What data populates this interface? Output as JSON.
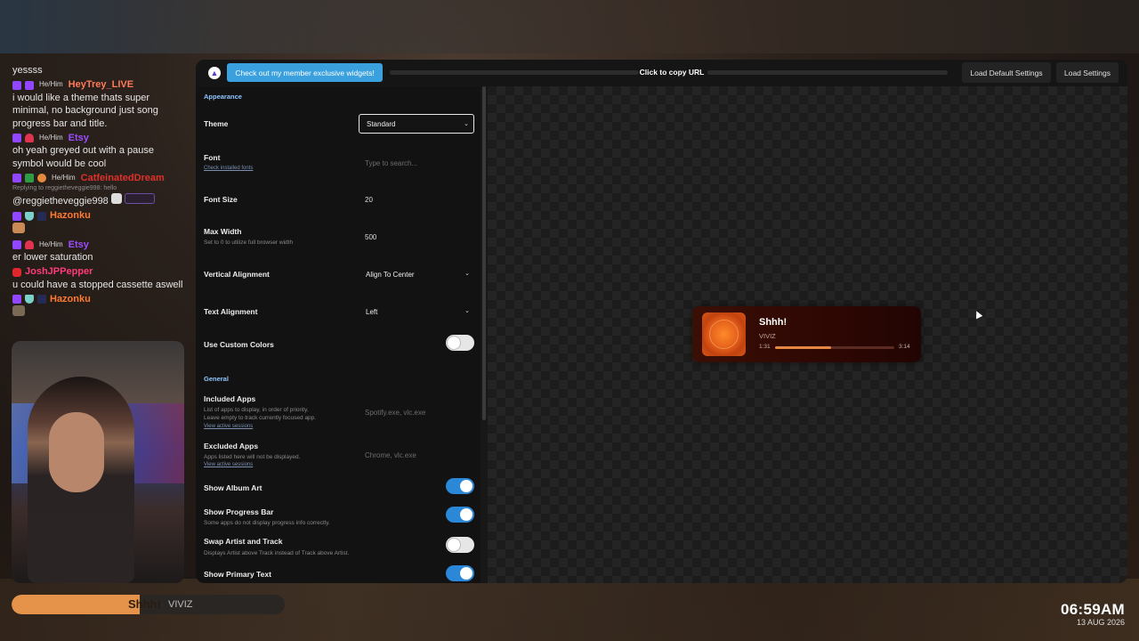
{
  "chat": {
    "messages": [
      {
        "user": "",
        "text": "yessss"
      },
      {
        "pronoun": "He/Him",
        "user": "HeyTrey_LIVE",
        "color": "#ff7a59",
        "text": "i would like a theme thats super minimal, no background just song progress bar and title."
      },
      {
        "pronoun": "He/Him",
        "user": "Etsy",
        "color": "#9b4dff",
        "text": "oh yeah greyed out with a pause symbol would be cool"
      },
      {
        "pronoun": "He/Him",
        "user": "CatfeinatedDream",
        "color": "#e0302b",
        "reply": "Replying to reggietheveggie998: hello",
        "text": "@reggietheveggie998"
      },
      {
        "user": "Hazonku",
        "color": "#ff7a30",
        "text": ""
      },
      {
        "pronoun": "He/Him",
        "user": "Etsy",
        "color": "#9b4dff",
        "text": "er lower saturation"
      },
      {
        "user": "JoshJPPepper",
        "color": "#ff3b7a",
        "text": "u could have a stopped cassette aswell"
      },
      {
        "user": "Hazonku",
        "color": "#ff7a30",
        "text": ""
      }
    ]
  },
  "now_playing_pill": {
    "title": "Shhh!",
    "artist": "VIVIZ",
    "progress": 0.47
  },
  "clock": {
    "time": "06:59AM",
    "date": "13 AUG 2026"
  },
  "topbar": {
    "member_button": "Check out my member exclusive widgets!",
    "copy_url": "Click to copy URL",
    "load_default": "Load Default Settings",
    "load_settings": "Load Settings"
  },
  "settings": {
    "appearance_title": "Appearance",
    "theme": {
      "label": "Theme",
      "value": "Standard"
    },
    "font": {
      "label": "Font",
      "link": "Check installed fonts",
      "placeholder": "Type to search..."
    },
    "font_size": {
      "label": "Font Size",
      "value": "20"
    },
    "max_width": {
      "label": "Max Width",
      "sub": "Set to 0 to utilize full browser width",
      "value": "500"
    },
    "vertical_alignment": {
      "label": "Vertical Alignment",
      "value": "Align To Center"
    },
    "text_alignment": {
      "label": "Text Alignment",
      "value": "Left"
    },
    "custom_colors": {
      "label": "Use Custom Colors",
      "on": false
    },
    "general_title": "General",
    "included_apps": {
      "label": "Included Apps",
      "sub1": "List of apps to display, in order of priority.",
      "sub2": "Leave empty to track currently focused app.",
      "link": "View active sessions",
      "placeholder": "Spotify.exe, vlc.exe"
    },
    "excluded_apps": {
      "label": "Excluded Apps",
      "sub": "Apps listed here will not be displayed.",
      "link": "View active sessions",
      "placeholder": "Chrome, vlc.exe"
    },
    "show_album_art": {
      "label": "Show Album Art",
      "on": true
    },
    "show_progress_bar": {
      "label": "Show Progress Bar",
      "sub": "Some apps do not display progress info correctly.",
      "on": true
    },
    "swap_artist": {
      "label": "Swap Artist and Track",
      "sub": "Displays Artist above Track instead of Track above Artist.",
      "on": false
    },
    "show_primary_text": {
      "label": "Show Primary Text",
      "on": true
    }
  },
  "widget": {
    "title": "Shhh!",
    "artist": "VIVIZ",
    "current": "1:31",
    "total": "3:14",
    "progress": 0.47
  }
}
